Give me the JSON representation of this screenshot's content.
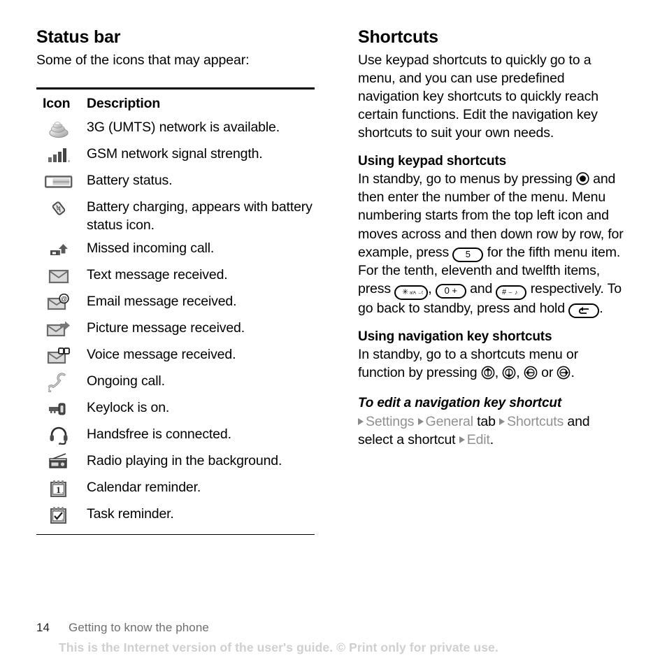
{
  "left": {
    "section_title": "Status bar",
    "intro": "Some of the icons that may appear:",
    "table": {
      "headers": {
        "icon": "Icon",
        "description": "Description"
      },
      "rows": [
        {
          "icon": "3g-umts-network-icon",
          "description": "3G (UMTS) network is available."
        },
        {
          "icon": "gsm-signal-strength-icon",
          "description": "GSM network signal strength."
        },
        {
          "icon": "battery-status-icon",
          "description": "Battery status."
        },
        {
          "icon": "battery-charging-icon",
          "description": "Battery charging, appears with battery status icon."
        },
        {
          "icon": "missed-incoming-call-icon",
          "description": "Missed incoming call."
        },
        {
          "icon": "text-message-icon",
          "description": "Text message received."
        },
        {
          "icon": "email-message-icon",
          "description": "Email message received."
        },
        {
          "icon": "picture-message-icon",
          "description": "Picture message received."
        },
        {
          "icon": "voice-message-icon",
          "description": "Voice message received."
        },
        {
          "icon": "ongoing-call-icon",
          "description": "Ongoing call."
        },
        {
          "icon": "keylock-icon",
          "description": "Keylock is on."
        },
        {
          "icon": "handsfree-icon",
          "description": "Handsfree is connected."
        },
        {
          "icon": "radio-icon",
          "description": "Radio playing in the background."
        },
        {
          "icon": "calendar-reminder-icon",
          "description": "Calendar reminder."
        },
        {
          "icon": "task-reminder-icon",
          "description": "Task reminder."
        }
      ]
    }
  },
  "right": {
    "section_title": "Shortcuts",
    "intro": "Use keypad shortcuts to quickly go to a menu, and you can use predefined navigation key shortcuts to quickly reach certain functions. Edit the navigation key shortcuts to suit your own needs.",
    "keypad": {
      "heading": "Using keypad shortcuts",
      "t1": "In standby, go to menus by pressing",
      "t2": "and then enter the number of the menu. Menu numbering starts from the top left icon and moves across and then down row by row, for example, press",
      "key_five": "5",
      "t3": "for the fifth menu item. For the tenth, eleventh and twelfth items, press",
      "key_star": "✳",
      "key_star_sub": "a/A →0",
      "sep1": ",",
      "key_zero": "0 +",
      "t4": "and",
      "key_hash": "#",
      "key_hash_sub": "⌣ ♪",
      "t5": "respectively. To go back to standby, press and hold",
      "key_back": "back-arrow",
      "t6": "."
    },
    "navigation": {
      "heading": "Using navigation key shortcuts",
      "t1": "In standby, go to a shortcuts menu or function by pressing",
      "nav_up": "nav-up",
      "sep1": ",",
      "nav_down": "nav-down",
      "sep2": ",",
      "nav_left": "nav-left",
      "t2": "or",
      "nav_right": "nav-right",
      "t3": "."
    },
    "procedure": {
      "title": "To edit a navigation key shortcut",
      "step_settings": "Settings",
      "step_general": "General",
      "step_tab": "tab",
      "step_shortcuts": "Shortcuts",
      "step_and_select": "and select a shortcut",
      "step_edit": "Edit",
      "step_period": "."
    }
  },
  "footer": {
    "page_number": "14",
    "chapter": "Getting to know the phone",
    "notice": "This is the Internet version of the user's guide. © Print only for private use."
  },
  "colors": {
    "text": "#000000",
    "muted": "#909090",
    "notice": "#cfcfcf",
    "icon_dark": "#4d4d4d",
    "icon_light": "#c8c8c8"
  }
}
